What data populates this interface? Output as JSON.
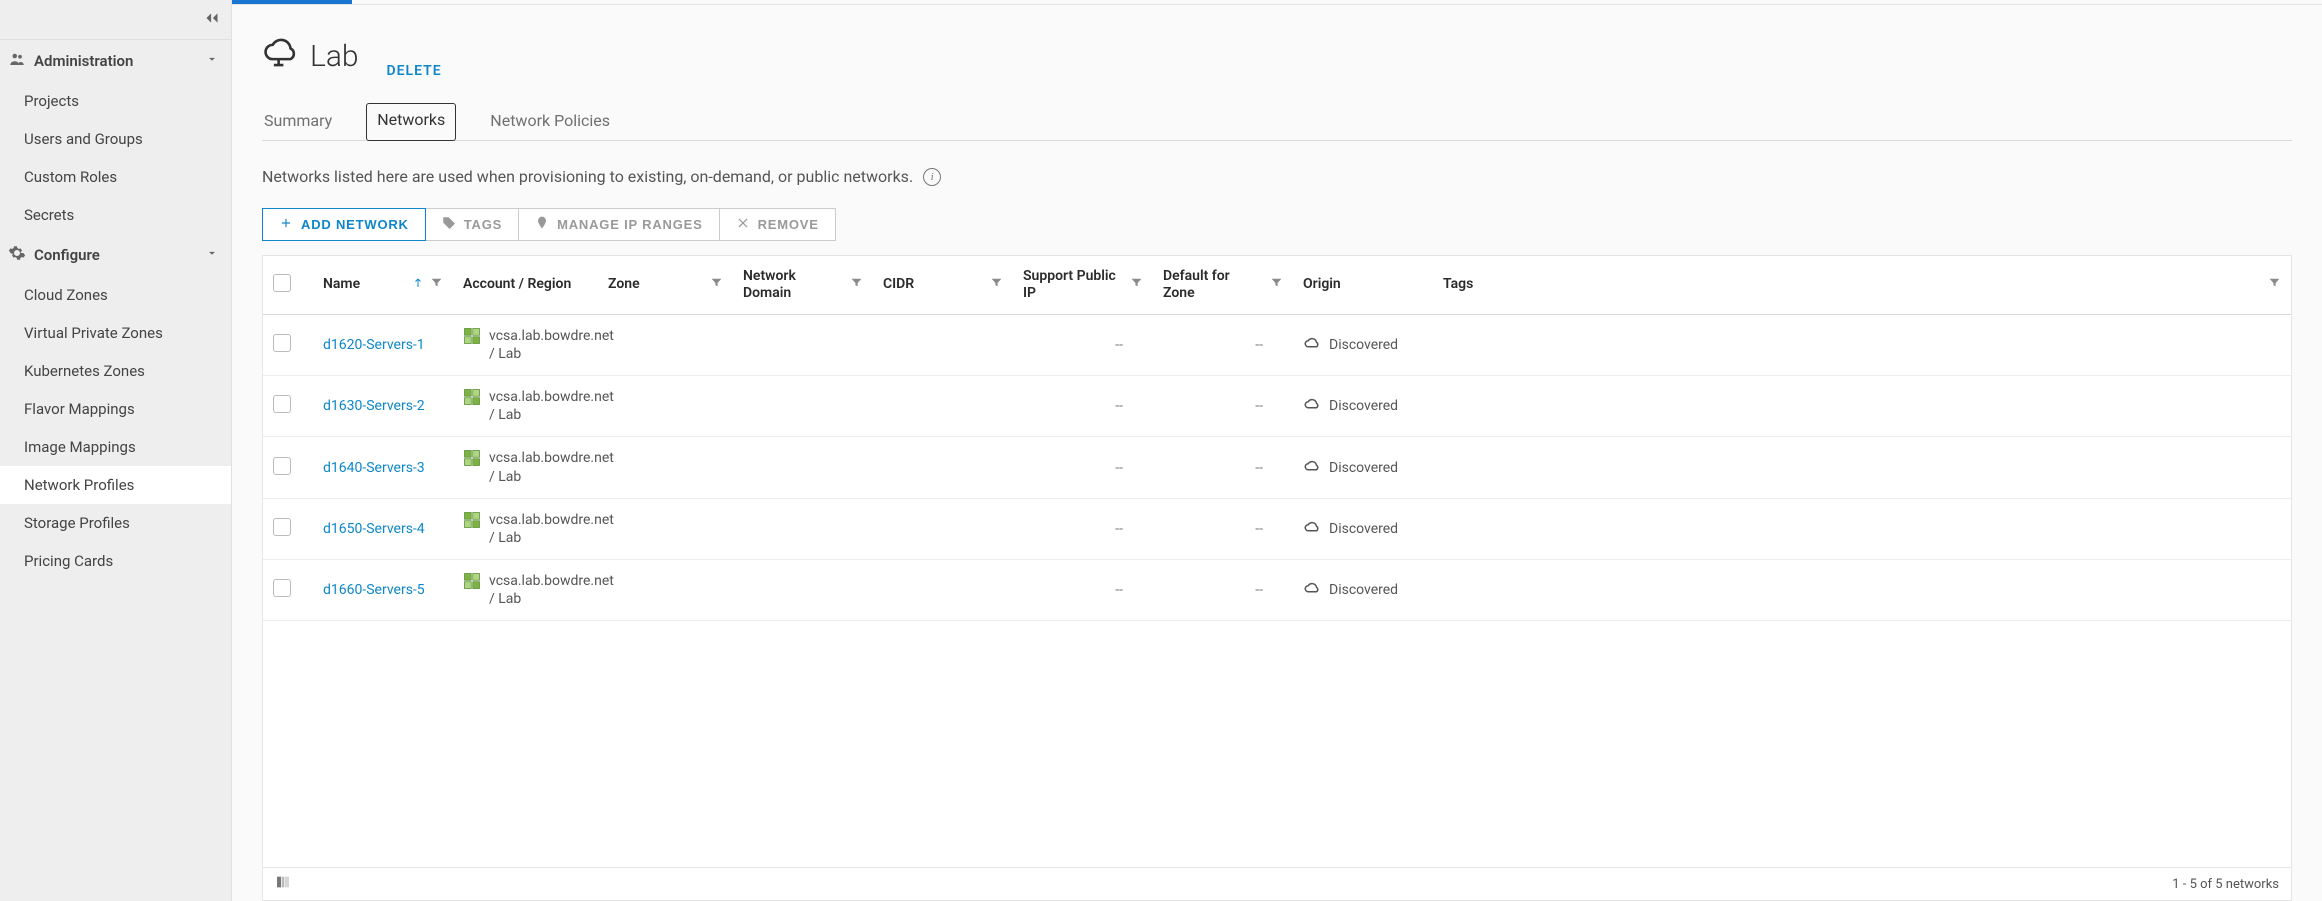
{
  "sidebar": {
    "sections": [
      {
        "label": "Administration",
        "items": [
          "Projects",
          "Users and Groups",
          "Custom Roles",
          "Secrets"
        ]
      },
      {
        "label": "Configure",
        "items": [
          "Cloud Zones",
          "Virtual Private Zones",
          "Kubernetes Zones",
          "Flavor Mappings",
          "Image Mappings",
          "Network Profiles",
          "Storage Profiles",
          "Pricing Cards"
        ],
        "active_index": 5
      }
    ]
  },
  "header": {
    "title": "Lab",
    "delete_action": "DELETE"
  },
  "tabs": {
    "items": [
      "Summary",
      "Networks",
      "Network Policies"
    ],
    "active_index": 1
  },
  "description": "Networks listed here are used when provisioning to existing, on-demand, or public networks.",
  "toolbar": {
    "add": "ADD NETWORK",
    "tags": "TAGS",
    "manage_ip": "MANAGE IP RANGES",
    "remove": "REMOVE"
  },
  "table": {
    "columns": {
      "name": "Name",
      "account": "Account / Region",
      "zone": "Zone",
      "network_domain": "Network Domain",
      "cidr": "CIDR",
      "support_public_ip": "Support Public IP",
      "default_for_zone": "Default for Zone",
      "origin": "Origin",
      "tags": "Tags"
    },
    "rows": [
      {
        "name": "d1620-Servers-1",
        "account": "vcsa.lab.bowdre.net / Lab",
        "zone": "",
        "network_domain": "",
        "cidr": "",
        "support_public_ip": "--",
        "default_for_zone": "--",
        "origin": "Discovered"
      },
      {
        "name": "d1630-Servers-2",
        "account": "vcsa.lab.bowdre.net / Lab",
        "zone": "",
        "network_domain": "",
        "cidr": "",
        "support_public_ip": "--",
        "default_for_zone": "--",
        "origin": "Discovered"
      },
      {
        "name": "d1640-Servers-3",
        "account": "vcsa.lab.bowdre.net / Lab",
        "zone": "",
        "network_domain": "",
        "cidr": "",
        "support_public_ip": "--",
        "default_for_zone": "--",
        "origin": "Discovered"
      },
      {
        "name": "d1650-Servers-4",
        "account": "vcsa.lab.bowdre.net / Lab",
        "zone": "",
        "network_domain": "",
        "cidr": "",
        "support_public_ip": "--",
        "default_for_zone": "--",
        "origin": "Discovered"
      },
      {
        "name": "d1660-Servers-5",
        "account": "vcsa.lab.bowdre.net / Lab",
        "zone": "",
        "network_domain": "",
        "cidr": "",
        "support_public_ip": "--",
        "default_for_zone": "--",
        "origin": "Discovered"
      }
    ],
    "footer": "1 - 5 of 5 networks"
  }
}
